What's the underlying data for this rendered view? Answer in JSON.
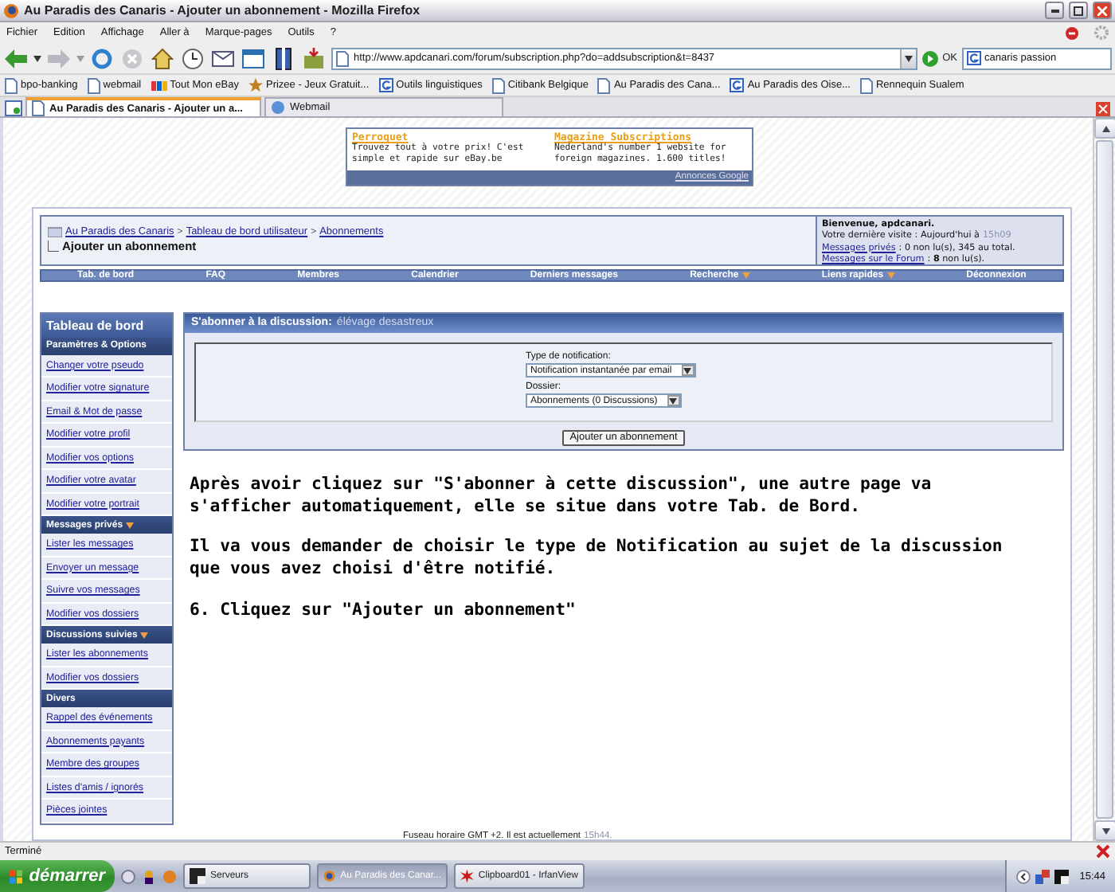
{
  "window": {
    "title": "Au Paradis des Canaris - Ajouter un abonnement - Mozilla Firefox"
  },
  "menu": [
    "Fichier",
    "Edition",
    "Affichage",
    "Aller à",
    "Marque-pages",
    "Outils",
    "?"
  ],
  "address_bar": {
    "url": "http://www.apdcanari.com/forum/subscription.php?do=addsubscription&t=8437",
    "go": "OK"
  },
  "search": {
    "value": "canaris passion"
  },
  "bookmarks": [
    {
      "label": "bpo-banking",
      "kind": "page"
    },
    {
      "label": "webmail",
      "kind": "page"
    },
    {
      "label": "Tout Mon eBay",
      "kind": "ebay"
    },
    {
      "label": "Prizee - Jeux Gratuit...",
      "kind": "prize"
    },
    {
      "label": "Outils linguistiques",
      "kind": "google"
    },
    {
      "label": "Citibank Belgique",
      "kind": "page"
    },
    {
      "label": "Au Paradis des Cana...",
      "kind": "page"
    },
    {
      "label": "Au Paradis des Oise...",
      "kind": "google"
    },
    {
      "label": "Rennequin Sualem",
      "kind": "page"
    }
  ],
  "tabs": [
    {
      "label": "Au Paradis des Canaris - Ajouter un a...",
      "selected": true
    },
    {
      "label": "Webmail",
      "selected": false
    }
  ],
  "ads": {
    "items": [
      {
        "title": "Perroquet",
        "text": "Trouvez tout à votre prix! C'est simple et rapide sur eBay.be"
      },
      {
        "title": "Magazine Subscriptions",
        "text": "Nederland's number 1 website for foreign magazines. 1.600 titles!"
      }
    ],
    "footer": "Annonces Google"
  },
  "breadcrumb": {
    "links": [
      "Au Paradis des Canaris",
      "Tableau de bord utilisateur",
      "Abonnements"
    ],
    "current": "Ajouter un abonnement",
    "separator": ">"
  },
  "welcome": {
    "greeting": "Bienvenue, apdcanari.",
    "last_visit": "Votre dernière visite : Aujourd'hui à",
    "last_visit_time": "15h09",
    "pm_link": "Messages privés",
    "pm_text": ": 0 non lu(s), 345 au total.",
    "forum_link": "Messages sur le Forum",
    "forum_text": ": **8** non lu(s)."
  },
  "navbar": [
    {
      "label": "Tab. de bord",
      "dropdown": false
    },
    {
      "label": "FAQ",
      "dropdown": false
    },
    {
      "label": "Membres",
      "dropdown": false
    },
    {
      "label": "Calendrier",
      "dropdown": false
    },
    {
      "label": "Derniers messages",
      "dropdown": false
    },
    {
      "label": "Recherche",
      "dropdown": true
    },
    {
      "label": "Liens rapides",
      "dropdown": true
    },
    {
      "label": "Déconnexion",
      "dropdown": false
    }
  ],
  "sidebar": {
    "title": "Tableau de bord",
    "sections": [
      {
        "title": "Paramètres & Options",
        "dropdown": false,
        "items": [
          "Changer votre pseudo",
          "Modifier votre signature",
          "Email & Mot de passe",
          "Modifier votre profil",
          "Modifier vos options",
          "Modifier votre avatar",
          "Modifier votre portrait"
        ]
      },
      {
        "title": "Messages privés",
        "dropdown": true,
        "items": [
          "Lister les messages",
          "Envoyer un message",
          "Suivre vos messages",
          "Modifier vos dossiers"
        ]
      },
      {
        "title": "Discussions suivies",
        "dropdown": true,
        "items": [
          "Lister les abonnements",
          "Modifier vos dossiers"
        ]
      },
      {
        "title": "Divers",
        "dropdown": false,
        "items": [
          "Rappel des événements",
          "Abonnements payants",
          "Membre des groupes",
          "Listes d'amis / ignorés",
          "Pièces jointes"
        ]
      }
    ]
  },
  "panel": {
    "title": "S'abonner à la discussion:",
    "subject": "élévage desastreux",
    "fields": [
      {
        "label": "Type de notification:",
        "value": "Notification instantanée par email"
      },
      {
        "label": "Dossier:",
        "value": "Abonnements (0 Discussions)"
      }
    ],
    "button": "Ajouter un abonnement"
  },
  "instructions": [
    "Après avoir cliquez sur \"S'abonner à cette discussion\", une autre page va s'afficher automatiquement, elle se situe dans votre Tab. de Bord.",
    "Il va vous demander de choisir le type de Notification au sujet de la discussion que vous avez choisi d'être notifié.",
    "6. Cliquez sur \"Ajouter un abonnement\""
  ],
  "footer": {
    "text": "Fuseau horaire GMT +2. Il est actuellement",
    "time": "15h44."
  },
  "status_bar": {
    "text": "Terminé"
  },
  "taskbar": {
    "start": "démarrer",
    "tasks": [
      {
        "label": "Serveurs",
        "kind": "terminal",
        "selected": false
      },
      {
        "label": "Au Paradis des Canar...",
        "kind": "browser",
        "selected": true
      },
      {
        "label": "Clipboard01 - IrfanView",
        "kind": "viewer",
        "selected": false
      }
    ],
    "clock": "15:44"
  }
}
